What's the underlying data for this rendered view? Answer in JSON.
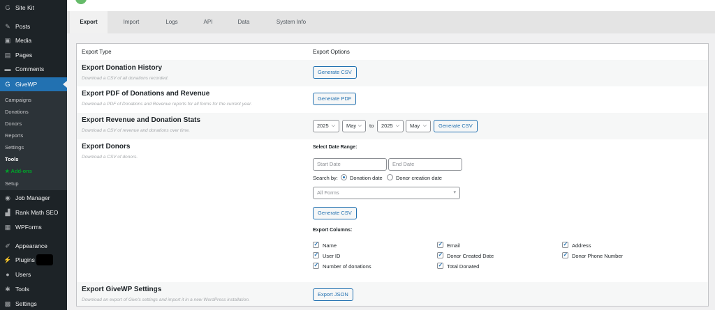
{
  "sidebar": {
    "items": [
      {
        "label": "Site Kit",
        "icon": "sitekit-icon",
        "glyph": "G"
      },
      {
        "label": "Posts",
        "icon": "pin-icon",
        "glyph": "✎"
      },
      {
        "label": "Media",
        "icon": "media-icon",
        "glyph": "▣"
      },
      {
        "label": "Pages",
        "icon": "pages-icon",
        "glyph": "▤"
      },
      {
        "label": "Comments",
        "icon": "comment-icon",
        "glyph": "▬"
      },
      {
        "label": "GiveWP",
        "icon": "givewp-icon",
        "glyph": "G"
      },
      {
        "label": "Job Manager",
        "icon": "jm-icon",
        "glyph": "◉"
      },
      {
        "label": "Rank Math SEO",
        "icon": "chart-icon",
        "glyph": "▟"
      },
      {
        "label": "WPForms",
        "icon": "wpforms-icon",
        "glyph": "▦"
      },
      {
        "label": "Appearance",
        "icon": "brush-icon",
        "glyph": "✐"
      },
      {
        "label": "Plugins",
        "icon": "plug-icon",
        "glyph": "⚡"
      },
      {
        "label": "Users",
        "icon": "user-icon",
        "glyph": "●"
      },
      {
        "label": "Tools",
        "icon": "wrench-icon",
        "glyph": "✱"
      },
      {
        "label": "Settings",
        "icon": "settings-icon",
        "glyph": "▩"
      }
    ],
    "submenu": [
      "Campaigns",
      "Donations",
      "Donors",
      "Reports",
      "Settings",
      "Tools",
      "★ Add-ons",
      "Setup"
    ]
  },
  "tabs": [
    "Export",
    "Import",
    "Logs",
    "API",
    "Data",
    "System Info"
  ],
  "panel": {
    "col_type": "Export Type",
    "col_options": "Export Options",
    "donation_history": {
      "title": "Export Donation History",
      "desc": "Download a CSV of all donations recorded.",
      "button": "Generate CSV"
    },
    "pdf": {
      "title": "Export PDF of Donations and Revenue",
      "desc": "Download a PDF of Donations and Revenue reports for all forms for the current year.",
      "button": "Generate PDF"
    },
    "stats": {
      "title": "Export Revenue and Donation Stats",
      "desc": "Download a CSV of revenue and donations over time.",
      "year_from": "2025",
      "month_from": "May",
      "to": "to",
      "year_to": "2025",
      "month_to": "May",
      "button": "Generate CSV"
    },
    "donors": {
      "title": "Export Donors",
      "desc": "Download a CSV of donors.",
      "range_label": "Select Date Range:",
      "start_placeholder": "Start Date",
      "end_placeholder": "End Date",
      "search_by": "Search by:",
      "radio_donation": "Donation date",
      "radio_creation": "Donor creation date",
      "forms_select": "All Forms",
      "button": "Generate CSV",
      "columns_label": "Export Columns:",
      "columns": [
        "Name",
        "Email",
        "Address",
        "User ID",
        "Donor Created Date",
        "Donor Phone Number",
        "Number of donations",
        "Total Donated"
      ]
    },
    "settings": {
      "title": "Export GiveWP Settings",
      "desc": "Download an export of Give's settings and import it in a new WordPress installation.",
      "button": "Export JSON"
    }
  },
  "colors": {
    "sidebar": "#1d2327",
    "active": "#2271b1",
    "addons": "#00a32a"
  }
}
